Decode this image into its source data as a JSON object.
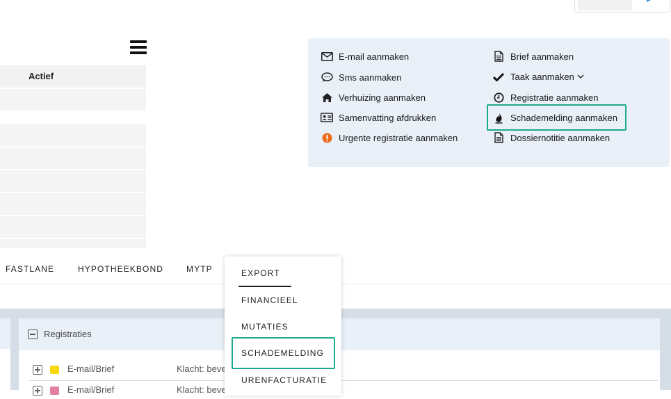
{
  "table": {
    "header_actief": "Actief"
  },
  "actions": {
    "left": [
      {
        "label": "E-mail aanmaken",
        "icon": "envelope-icon"
      },
      {
        "label": "Sms aanmaken",
        "icon": "chat-bubble-icon"
      },
      {
        "label": "Verhuizing aanmaken",
        "icon": "home-icon"
      },
      {
        "label": "Samenvatting afdrukken",
        "icon": "id-card-icon"
      },
      {
        "label": "Urgente registratie aanmaken",
        "icon": "exclamation-circle-icon"
      }
    ],
    "right": [
      {
        "label": "Brief aanmaken",
        "icon": "document-icon"
      },
      {
        "label": "Taak aanmaken",
        "icon": "checkmark-icon"
      },
      {
        "label": "Registratie aanmaken",
        "icon": "clock-icon"
      },
      {
        "label": "Schademelding aanmaken",
        "icon": "flame-icon"
      },
      {
        "label": "Dossiernotitie aanmaken",
        "icon": "document-icon"
      }
    ]
  },
  "nav": {
    "tabs": [
      "FASTLANE",
      "HYPOTHEEKBOND",
      "MYTP"
    ]
  },
  "dropdown": {
    "items": [
      "EXPORT",
      "FINANCIEEL",
      "MUTATIES",
      "SCHADEMELDING",
      "URENFACTURATIE"
    ]
  },
  "registraties": {
    "title": "Registraties",
    "rows": [
      {
        "type": "E-mail/Brief",
        "desc": "Klacht: beve",
        "color": "#f5d90a"
      },
      {
        "type": "E-mail/Brief",
        "desc": "Klacht: beve",
        "color": "#e57fa0"
      }
    ]
  },
  "colors": {
    "highlight": "#1fa98c",
    "urgent": "#f06a1c"
  }
}
